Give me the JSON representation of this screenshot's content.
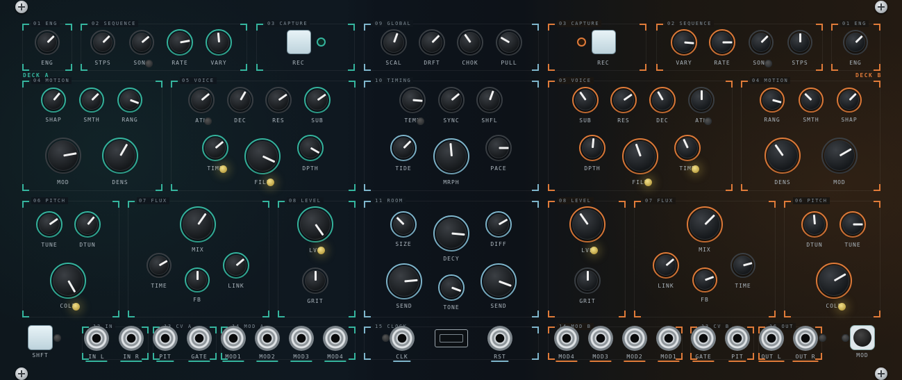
{
  "colors": {
    "deck_a": "#35b59e",
    "global": "#7fb6cc",
    "deck_b": "#e07b39"
  },
  "deck_a": {
    "label": "DECK A",
    "eng": {
      "title": "01 ENG",
      "knob": "ENG"
    },
    "sequence": {
      "title": "02 SEQUENCE",
      "knobs": [
        "STPS",
        "SONG",
        "RATE",
        "VARY"
      ]
    },
    "capture": {
      "title": "03 CAPTURE",
      "button": "REC"
    },
    "motion": {
      "title": "04 MOTION",
      "knobs": [
        "SHAP",
        "SMTH",
        "RANG",
        "MOD",
        "DENS"
      ]
    },
    "voice": {
      "title": "05 VOICE",
      "knobs": [
        "ATK",
        "DEC",
        "RES",
        "SUB",
        "TIMB",
        "FILT",
        "DPTH"
      ]
    },
    "pitch": {
      "title": "06 PITCH",
      "knobs": [
        "TUNE",
        "DTUN",
        "COLR"
      ]
    },
    "flux": {
      "title": "07 FLUX",
      "knobs": [
        "MIX",
        "TIME",
        "FB",
        "LINK"
      ]
    },
    "level": {
      "title": "08 LEVEL",
      "knobs": [
        "LVL",
        "GRIT"
      ]
    }
  },
  "global": {
    "global": {
      "title": "09 GLOBAL",
      "knobs": [
        "SCAL",
        "DRFT",
        "CHOK",
        "PULL"
      ]
    },
    "timing": {
      "title": "10 TIMING",
      "knobs": [
        "TEMP",
        "SYNC",
        "SHFL",
        "TIDE",
        "MRPH",
        "PACE"
      ]
    },
    "room": {
      "title": "11 ROOM",
      "knobs": [
        "SIZE",
        "DECY",
        "DIFF",
        "SEND",
        "TONE",
        "SEND"
      ]
    }
  },
  "deck_b": {
    "label": "DECK B",
    "eng": {
      "title": "01 ENG",
      "knob": "ENG"
    },
    "sequence": {
      "title": "02 SEQUENCE",
      "knobs": [
        "VARY",
        "RATE",
        "SONG",
        "STPS"
      ]
    },
    "capture": {
      "title": "03 CAPTURE",
      "button": "REC"
    },
    "motion": {
      "title": "04 MOTION",
      "knobs": [
        "RANG",
        "SMTH",
        "SHAP",
        "DENS",
        "MOD"
      ]
    },
    "voice": {
      "title": "05 VOICE",
      "knobs": [
        "SUB",
        "RES",
        "DEC",
        "ATK",
        "DPTH",
        "FILT",
        "TIMB"
      ]
    },
    "pitch": {
      "title": "06 PITCH",
      "knobs": [
        "DTUN",
        "TUNE",
        "COLR"
      ]
    },
    "flux": {
      "title": "07 FLUX",
      "knobs": [
        "MIX",
        "LINK",
        "FB",
        "TIME"
      ]
    },
    "level": {
      "title": "08 LEVEL",
      "knobs": [
        "LVL",
        "GRIT"
      ]
    }
  },
  "io": {
    "shift": "SHFT",
    "in": {
      "title": "12 IN",
      "jacks": [
        "IN L",
        "IN R"
      ]
    },
    "cv_a": {
      "title": "13 CV A",
      "jacks": [
        "PIT",
        "GATE"
      ]
    },
    "mod_a": {
      "title": "14 MOD A",
      "jacks": [
        "MOD1",
        "MOD2",
        "MOD3",
        "MOD4"
      ]
    },
    "clock": {
      "title": "15 CLOCK",
      "jacks": [
        "CLK",
        "RST"
      ]
    },
    "mod_b": {
      "title": "14 MOD B",
      "jacks": [
        "MOD4",
        "MOD3",
        "MOD2",
        "MOD1"
      ]
    },
    "cv_b": {
      "title": "13 CV B",
      "jacks": [
        "GATE",
        "PIT"
      ]
    },
    "out": {
      "title": "16 OUT",
      "jacks": [
        "OUT L",
        "OUT R"
      ]
    },
    "mod": "MOD"
  },
  "icons": {
    "screw": "screw-icon"
  }
}
